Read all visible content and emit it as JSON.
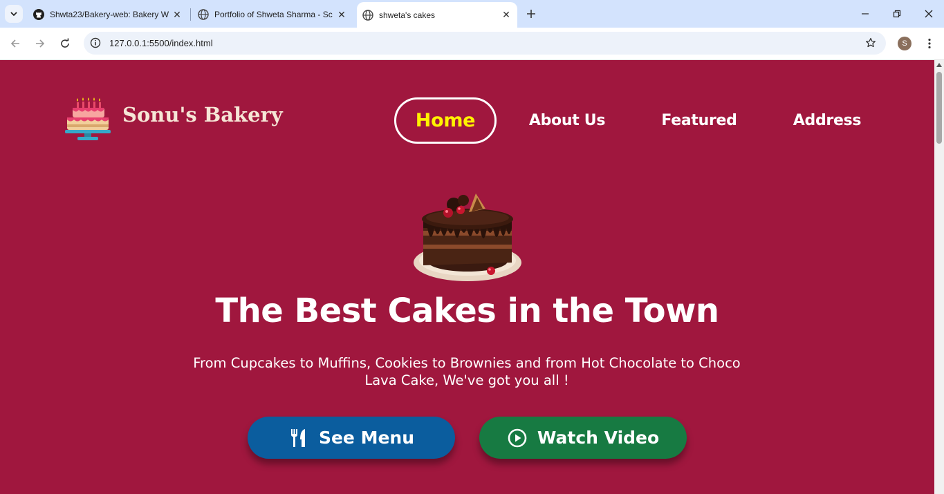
{
  "browser": {
    "tabs": [
      {
        "title": "Shwta23/Bakery-web: Bakery W",
        "icon": "github-icon",
        "active": false
      },
      {
        "title": "Portfolio of Shweta Sharma - Sc",
        "icon": "globe-icon",
        "active": false
      },
      {
        "title": "shweta's cakes",
        "icon": "globe-icon",
        "active": true
      }
    ],
    "url": "127.0.0.1:5500/index.html",
    "profile_initial": "S"
  },
  "site": {
    "brand": "Sonu's Bakery",
    "nav": [
      {
        "label": "Home",
        "active": true
      },
      {
        "label": "About Us",
        "active": false
      },
      {
        "label": "Featured",
        "active": false
      },
      {
        "label": "Address",
        "active": false
      }
    ],
    "hero": {
      "title": "The Best Cakes in the Town",
      "subtitle": "From Cupcakes to Muffins, Cookies to Brownies and from Hot Chocolate to Choco Lava Cake, We've got you all !",
      "buttons": [
        {
          "label": "See Menu",
          "icon": "utensils-icon"
        },
        {
          "label": "Watch Video",
          "icon": "play-circle-icon"
        }
      ]
    }
  },
  "colors": {
    "page_background": "#a0173e",
    "active_nav_text": "#fff200",
    "menu_button": "#0b5d9e",
    "video_button": "#177a42",
    "brand_text": "#f6e6d6"
  }
}
